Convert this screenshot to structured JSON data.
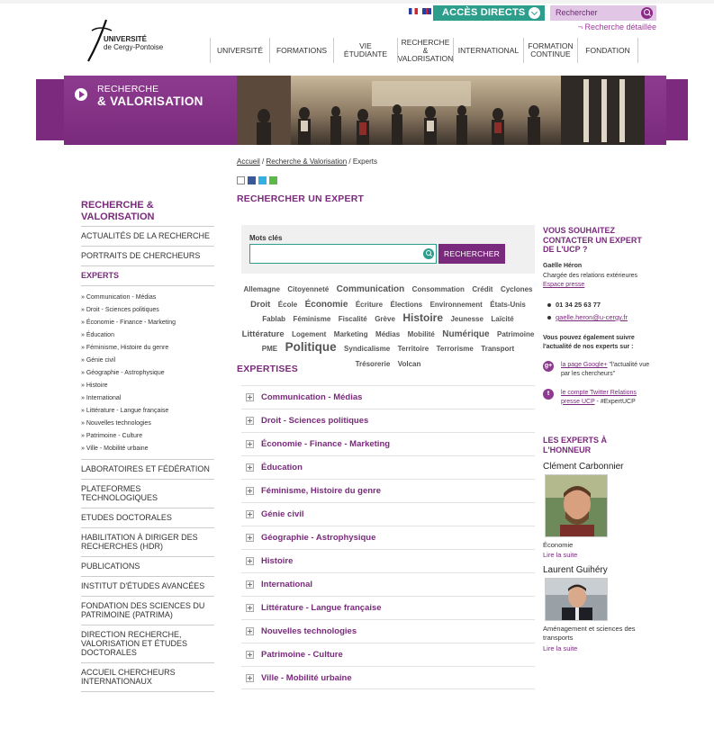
{
  "topbar": {
    "acces_directs": "ACCÈS DIRECTS",
    "search_placeholder": "Rechercher",
    "recherche_detaillee": "¬ Recherche détaillée"
  },
  "logo": {
    "line1": "UNIVERSITÉ",
    "line2": "de Cergy-Pontoise"
  },
  "nav": {
    "items": [
      {
        "label": "UNIVERSITÉ"
      },
      {
        "label": "FORMATIONS"
      },
      {
        "label": "VIE ÉTUDIANTE"
      },
      {
        "label": "RECHERCHE & VALORISATION"
      },
      {
        "label": "INTERNATIONAL"
      },
      {
        "label": "FORMATION CONTINUE"
      },
      {
        "label": "FONDATION"
      }
    ]
  },
  "banner": {
    "line1": "RECHERCHE",
    "line2": "& VALORISATION"
  },
  "breadcrumb": {
    "home": "Accueil",
    "sep": " / ",
    "section": "Recherche & Valorisation",
    "current": "Experts"
  },
  "page_title": "RECHERCHER UN EXPERT",
  "sidebar": {
    "title": "RECHERCHE & VALORISATION",
    "items_top": [
      {
        "label": "ACTUALITÉS DE LA RECHERCHE"
      },
      {
        "label": "PORTRAITS DE CHERCHEURS"
      },
      {
        "label": "EXPERTS"
      }
    ],
    "sub_items": [
      "» Communication - Médias",
      "» Droit - Sciences politiques",
      "» Économie - Finance - Marketing",
      "» Éducation",
      "» Féminisme, Histoire du genre",
      "» Génie civil",
      "» Géographie - Astrophysique",
      "» Histoire",
      "» International",
      "» Littérature - Langue française",
      "» Nouvelles technologies",
      "» Patrimoine - Culture",
      "» Ville - Mobilité urbaine"
    ],
    "items_bottom": [
      {
        "label": "LABORATOIRES ET FÉDÉRATION"
      },
      {
        "label": "PLATEFORMES TECHNOLOGIQUES"
      },
      {
        "label": "ETUDES DOCTORALES"
      },
      {
        "label": "HABILITATION À DIRIGER DES RECHERCHES (HDR)"
      },
      {
        "label": "PUBLICATIONS"
      },
      {
        "label": "INSTITUT D'ÉTUDES AVANCÉES"
      },
      {
        "label": "FONDATION DES SCIENCES DU PATRIMOINE (PATRIMA)"
      },
      {
        "label": "DIRECTION RECHERCHE, VALORISATION ET ÉTUDES DOCTORALES"
      },
      {
        "label": "ACCUEIL CHERCHEURS INTERNATIONAUX"
      }
    ]
  },
  "search": {
    "label": "Mots clés",
    "value": "",
    "button": "RECHERCHER"
  },
  "tags": [
    {
      "t": "Allemagne",
      "s": 8
    },
    {
      "t": "Citoyenneté",
      "s": 8
    },
    {
      "t": "Communication",
      "s": 10
    },
    {
      "t": "Consommation",
      "s": 8
    },
    {
      "t": "Crédit",
      "s": 8
    },
    {
      "t": "Cyclones",
      "s": 8
    },
    {
      "t": "Droit",
      "s": 9.5
    },
    {
      "t": "École",
      "s": 8
    },
    {
      "t": "Économie",
      "s": 10
    },
    {
      "t": "Écriture",
      "s": 8
    },
    {
      "t": "Élections",
      "s": 8
    },
    {
      "t": "Environnement",
      "s": 8
    },
    {
      "t": "États-Unis",
      "s": 8
    },
    {
      "t": "Fablab",
      "s": 8
    },
    {
      "t": "Féminisme",
      "s": 8
    },
    {
      "t": "Fiscalité",
      "s": 8
    },
    {
      "t": "Grève",
      "s": 8
    },
    {
      "t": "Histoire",
      "s": 12
    },
    {
      "t": "Jeunesse",
      "s": 8
    },
    {
      "t": "Laïcité",
      "s": 8
    },
    {
      "t": "Littérature",
      "s": 9.5
    },
    {
      "t": "Logement",
      "s": 8
    },
    {
      "t": "Marketing",
      "s": 8
    },
    {
      "t": "Médias",
      "s": 8
    },
    {
      "t": "Mobilité",
      "s": 8
    },
    {
      "t": "Numérique",
      "s": 10
    },
    {
      "t": "Patrimoine",
      "s": 8
    },
    {
      "t": "PME",
      "s": 8
    },
    {
      "t": "Politique",
      "s": 13.5
    },
    {
      "t": "Syndicalisme",
      "s": 8
    },
    {
      "t": "Territoire",
      "s": 8
    },
    {
      "t": "Terrorisme",
      "s": 8
    },
    {
      "t": "Transport",
      "s": 8
    },
    {
      "t": "Trésorerie",
      "s": 8
    },
    {
      "t": "Volcan",
      "s": 8
    }
  ],
  "expertises": {
    "title": "EXPERTISES",
    "items": [
      "Communication - Médias",
      "Droit - Sciences politiques",
      "Économie - Finance - Marketing",
      "Éducation",
      "Féminisme, Histoire du genre",
      "Génie civil",
      "Géographie - Astrophysique",
      "Histoire",
      "International",
      "Littérature - Langue française",
      "Nouvelles technologies",
      "Patrimoine - Culture",
      "Ville - Mobilité urbaine"
    ]
  },
  "contact": {
    "title": "VOUS SOUHAITEZ CONTACTER UN EXPERT DE L'UCP ?",
    "name": "Gaëlle Héron",
    "role": "Chargée des relations extérieures",
    "press": "Espace presse",
    "phone": "01 34 25 63 77",
    "email": "gaelle.heron@u-cergy.fr",
    "follow": "Vous pouvez également suivre l'actualité de nos experts sur :",
    "google_link": "la page Google+",
    "google_text": " \"l'actualité vue par les chercheurs\"",
    "twitter_link": "le compte Twitter Relations presse UCP",
    "twitter_text": " - #ExpertUCP"
  },
  "honneur": {
    "title": "LES EXPERTS À L'HONNEUR",
    "experts": [
      {
        "name": "Clément Carbonnier",
        "field": "Économie",
        "more": "Lire la suite"
      },
      {
        "name": "Laurent Guihéry",
        "field": "Aménagement et sciences des transports",
        "more": "Lire la suite"
      }
    ]
  },
  "colors": {
    "accent": "#7a2a7c",
    "teal": "#2d9e8c"
  }
}
